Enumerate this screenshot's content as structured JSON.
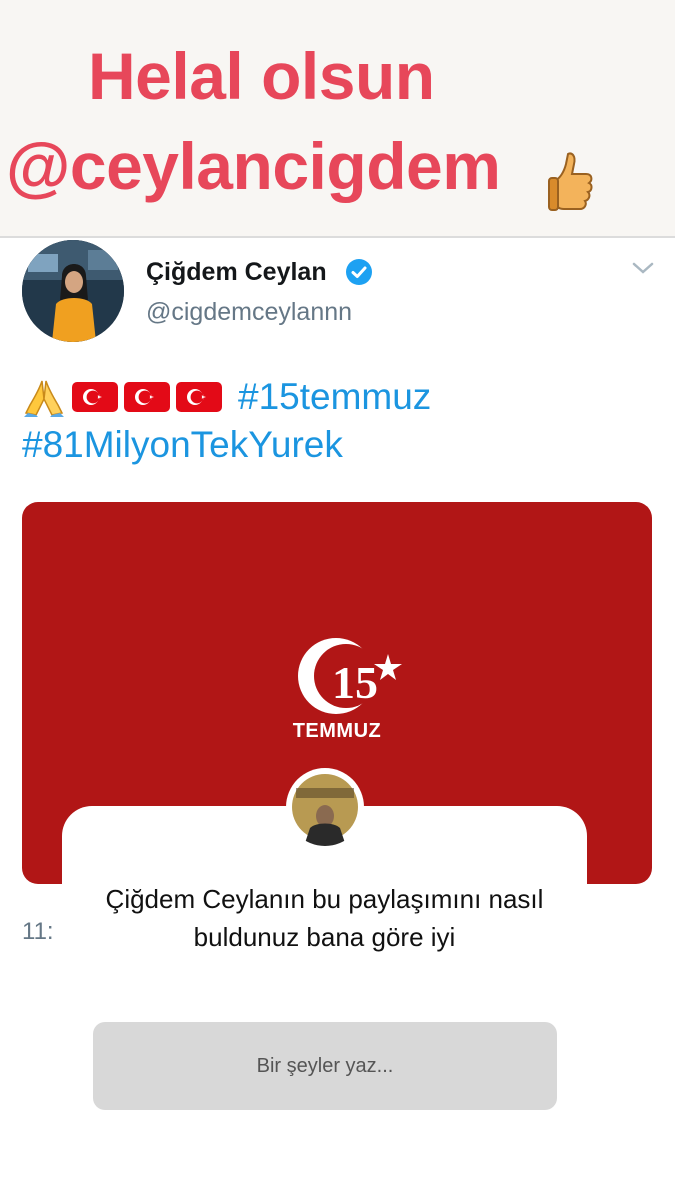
{
  "caption": {
    "line1": "Helal olsun",
    "line2": "@ceylancigdem",
    "sticker_icon": "thumbs-up-icon"
  },
  "tweet": {
    "display_name": "Çiğdem Ceylan",
    "handle": "@cigdemceylannn",
    "verified_icon": "verified-badge-icon",
    "menu_icon": "chevron-down-icon",
    "emoji": [
      "folded-hands-icon",
      "turkish-flag-icon",
      "turkish-flag-icon",
      "turkish-flag-icon"
    ],
    "hashtag1": "#15temmuz",
    "hashtag2": "#81MilyonTekYurek",
    "media": {
      "logo_number": "15",
      "logo_text": "TEMMUZ",
      "background_color": "#b11616"
    },
    "timestamp": "11:"
  },
  "question_sticker": {
    "question": "Çiğdem Ceylanın bu paylaşımını nasıl buldunuz bana göre iyi",
    "placeholder": "Bir şeyler yaz..."
  },
  "colors": {
    "caption": "#e7475a",
    "hashtag": "#1b95e0",
    "handle": "#657786"
  }
}
